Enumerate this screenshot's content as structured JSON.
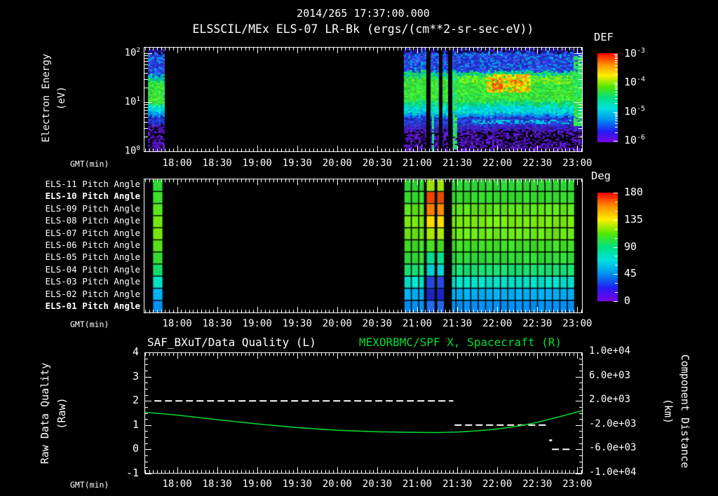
{
  "header": {
    "timestamp": "2014/265 17:37:00.000",
    "instrument_title": "ELSSCIL/MEx ELS-07 LR-Bk  (ergs/(cm**2-sr-sec-eV))"
  },
  "time_axis": {
    "label": "GMT(min)",
    "tick_labels": [
      "18:00",
      "18:30",
      "19:00",
      "19:30",
      "20:00",
      "20:30",
      "21:00",
      "21:30",
      "22:00",
      "22:30",
      "23:00"
    ],
    "start": "17:35",
    "end": "23:04"
  },
  "panel_energy": {
    "ylabel_line1": "Electron Energy",
    "ylabel_line2": "(eV)",
    "ytick_exponents": [
      "2",
      "1",
      "0"
    ],
    "colorbar": {
      "title": "DEF",
      "tick_exponents": [
        "-3",
        "-4",
        "-5",
        "-6"
      ]
    }
  },
  "panel_pitch": {
    "row_labels": [
      "ELS-11 Pitch Angle",
      "ELS-10 Pitch Angle",
      "ELS-09 Pitch Angle",
      "ELS-08 Pitch Angle",
      "ELS-07 Pitch Angle",
      "ELS-06 Pitch Angle",
      "ELS-05 Pitch Angle",
      "ELS-04 Pitch Angle",
      "ELS-03 Pitch Angle",
      "ELS-02 Pitch Angle",
      "ELS-01 Pitch Angle"
    ],
    "bold_rows": [
      "ELS-10 Pitch Angle",
      "ELS-01 Pitch Angle"
    ],
    "colorbar": {
      "title": "Deg",
      "ticks": [
        "180",
        "135",
        "90",
        "45",
        "0"
      ]
    }
  },
  "panel_line": {
    "title_left": "SAF_BXuT/Data Quality (L)",
    "title_right": "MEXORBMC/SPF X, Spacecraft (R)",
    "ylabel_line1": "Raw Data Quality",
    "ylabel_line2": "(Raw)",
    "ytick_labels": [
      "4",
      "3",
      "2",
      "1",
      "0",
      "-1"
    ],
    "y2label_line1": "Component Distance",
    "y2label_line2": "(km)",
    "y2tick_labels": [
      "1.0e+04",
      "6.0e+03",
      "2.0e+03",
      "-2.0e+03",
      "-6.0e+03",
      "-1.0e+04"
    ]
  },
  "colors": {
    "background": "#000000",
    "foreground": "#ffffff",
    "title_right_green": "#00dd33",
    "spacecraft_line_green": "#00d22c",
    "rainbow_gradient": [
      "#ff0000",
      "#ff9000",
      "#ffee00",
      "#55e800",
      "#00e080",
      "#00e0e0",
      "#0090f0",
      "#2020f0",
      "#7a00e8"
    ]
  },
  "chart_data": [
    {
      "type": "heatmap",
      "name": "electron-energy-spectrogram",
      "xlabel": "GMT(min)",
      "x_range": [
        "17:35",
        "23:04"
      ],
      "ylabel": "Electron Energy (eV)",
      "y_scale": "log",
      "y_range_ev": [
        1,
        140
      ],
      "colorbar_title": "DEF",
      "colorbar_units": "ergs/(cm**2-sr-sec-eV)",
      "colorbar_range": [
        1e-06,
        0.001
      ],
      "segments": [
        {
          "start": "17:38",
          "end": "17:50",
          "bands": [
            {
              "frac": [
                0.0,
                0.05
              ],
              "def": 3e-06,
              "colors": [
                "#1c1498",
                "#2a18ac",
                "#14106c",
                "#000000"
              ]
            },
            {
              "frac": [
                0.05,
                0.27
              ],
              "def": 1e-05,
              "colors": [
                "#2336d8",
                "#2c44e4",
                "#1a2cc0",
                "#3a55ec",
                "#00a0e0"
              ]
            },
            {
              "frac": [
                0.27,
                0.33
              ],
              "def": 4e-05,
              "colors": [
                "#00c890",
                "#18d868",
                "#00bcc8"
              ]
            },
            {
              "frac": [
                0.33,
                0.55
              ],
              "def": 0.00012,
              "colors": [
                "#30e040",
                "#3ce438",
                "#28dc50",
                "#52e82c"
              ]
            },
            {
              "frac": [
                0.55,
                0.62
              ],
              "def": 4e-05,
              "colors": [
                "#00d8d8",
                "#00c8e8",
                "#00e4c0"
              ]
            },
            {
              "frac": [
                0.62,
                0.66
              ],
              "def": 2e-05,
              "colors": [
                "#00a0f0",
                "#0090e8"
              ]
            },
            {
              "frac": [
                0.66,
                0.74
              ],
              "def": 1e-05,
              "colors": [
                "#2038cc",
                "#2844dc",
                "#1828b0"
              ]
            },
            {
              "frac": [
                0.74,
                1.0
              ],
              "def": 2e-06,
              "colors": [
                "#5414c0",
                "#440ea4",
                "#6420d4",
                "#000000",
                "#30087c",
                "#000000"
              ]
            }
          ]
        },
        {
          "start": "20:50",
          "end": "23:03",
          "bands": [
            {
              "frac": [
                0.0,
                0.045
              ],
              "def": 3e-06,
              "colors": [
                "#1c1498",
                "#2a18ac",
                "#14106c",
                "#000000"
              ]
            },
            {
              "frac": [
                0.045,
                0.23
              ],
              "def": 1e-05,
              "colors": [
                "#2336d8",
                "#2c44e4",
                "#1a2cc0",
                "#3a55ec",
                "#00a0e0"
              ]
            },
            {
              "frac": [
                0.23,
                0.29
              ],
              "def": 4e-05,
              "colors": [
                "#00c890",
                "#18d868",
                "#00bcc8",
                "#2ce04a"
              ]
            },
            {
              "frac": [
                0.29,
                0.52
              ],
              "def": 0.00015,
              "colors": [
                "#30e040",
                "#3ce438",
                "#28dc50",
                "#52e82c"
              ]
            },
            {
              "frac": [
                0.52,
                0.565
              ],
              "def": 6e-05,
              "colors": [
                "#10d888",
                "#00dcb0",
                "#1ed862"
              ]
            },
            {
              "frac": [
                0.565,
                0.635
              ],
              "def": 3e-05,
              "colors": [
                "#00d8d8",
                "#00c8e8",
                "#00e4c0"
              ]
            },
            {
              "frac": [
                0.635,
                0.665
              ],
              "def": 2e-05,
              "colors": [
                "#00a0f0",
                "#0090e8"
              ]
            },
            {
              "frac": [
                0.665,
                0.75
              ],
              "def": 1e-05,
              "colors": [
                "#2038cc",
                "#2844dc",
                "#1828b0",
                "#3050e4"
              ]
            },
            {
              "frac": [
                0.75,
                0.8
              ],
              "def": 5e-06,
              "colors": [
                "#3820b8",
                "#2c18a8",
                "#4828cc"
              ]
            },
            {
              "frac": [
                0.8,
                1.0
              ],
              "def": 2e-06,
              "colors": [
                "#5414c0",
                "#440ea4",
                "#6420d4",
                "#000000",
                "#30087c",
                "#000000"
              ]
            }
          ],
          "enhancements": [
            {
              "start": "21:30",
              "end": "22:56",
              "frac": [
                0.27,
                0.35
              ],
              "def": 0.0002,
              "colors": [
                "#7ce818",
                "#98ec0c",
                "#52e82c"
              ],
              "density": 0.55
            },
            {
              "start": "21:52",
              "end": "22:25",
              "frac": [
                0.26,
                0.43
              ],
              "def": 0.0003,
              "colors": [
                "#d8ec00",
                "#ffe400",
                "#fac800",
                "#ff9800"
              ],
              "density": 0.75
            },
            {
              "start": "21:56",
              "end": "22:04",
              "frac": [
                0.3,
                0.41
              ],
              "def": 0.0006,
              "colors": [
                "#ff7000",
                "#ff4600",
                "#ff9800"
              ],
              "density": 0.7
            },
            {
              "start": "22:10",
              "end": "22:19",
              "frac": [
                0.3,
                0.38
              ],
              "def": 0.0005,
              "colors": [
                "#ff8400",
                "#ffb000",
                "#ff6000"
              ],
              "density": 0.6
            },
            {
              "start": "21:40",
              "end": "22:55",
              "frac": [
                0.695,
                0.73
              ],
              "def": 3e-05,
              "colors": [
                "#00c8d8",
                "#00b4e0"
              ],
              "density": 0.5
            },
            {
              "start": "22:57",
              "end": "23:03",
              "frac": [
                0.08,
                0.75
              ],
              "def": 0.00012,
              "colors": [
                "#2ce44a",
                "#3ce83c",
                "#20e080"
              ],
              "density": 0.85
            },
            {
              "start": "21:27",
              "end": "21:29",
              "frac": [
                0.25,
                0.97
              ],
              "def": 0.0001,
              "colors": [
                "#2ce44a",
                "#20e080"
              ],
              "density": 0.9
            },
            {
              "start": "21:11",
              "end": "21:12",
              "frac": [
                0.55,
                1.0
              ],
              "def": 8e-05,
              "colors": [
                "#20e080",
                "#00d8b0"
              ],
              "density": 0.9
            }
          ],
          "gaps": [
            [
              "21:07",
              "21:10"
            ],
            [
              "21:16",
              "21:19"
            ],
            [
              "21:23",
              "21:26"
            ]
          ]
        }
      ]
    },
    {
      "type": "heatmap",
      "name": "pitch-angle-panels",
      "rows": [
        "ELS-11",
        "ELS-10",
        "ELS-09",
        "ELS-08",
        "ELS-07",
        "ELS-06",
        "ELS-05",
        "ELS-04",
        "ELS-03",
        "ELS-02",
        "ELS-01"
      ],
      "value_units": "deg",
      "colorbar_range": [
        0,
        180
      ],
      "segments": [
        {
          "start": "17:42",
          "end": "17:49",
          "style": "strip",
          "pitch_deg": [
            103,
            104,
            112,
            121,
            124,
            114,
            105,
            88,
            63,
            46,
            34
          ],
          "colors": [
            "#2ed636",
            "#3cdc2a",
            "#55e21e",
            "#70e812",
            "#7cec0c",
            "#58e41c",
            "#36da30",
            "#14dd6c",
            "#00e4c6",
            "#00b2f4",
            "#0092f2"
          ]
        },
        {
          "start": "20:50",
          "end": "22:58",
          "style": "grid",
          "columns": 23,
          "pitch_deg": [
            103,
            105,
            115,
            123,
            119,
            108,
            101,
            87,
            62,
            44,
            32
          ],
          "colors": [
            "#2ed636",
            "#36da2e",
            "#5ee41a",
            "#78ea0e",
            "#6ae816",
            "#40dc26",
            "#30da3a",
            "#18dd72",
            "#00e2ca",
            "#00aef4",
            "#008ef2"
          ],
          "gaps": [
            [
              "21:05",
              "21:07"
            ],
            [
              "21:13",
              "21:15"
            ],
            [
              "21:20",
              "21:26"
            ]
          ],
          "anomalous_columns": [
            {
              "start": "21:07",
              "end": "21:13",
              "pitch_deg": [
                128,
                172,
                156,
                137,
                127,
                106,
                78,
                62,
                38,
                26,
                42
              ],
              "colors": [
                "#a0e80a",
                "#f04000",
                "#ff7c00",
                "#ffd800",
                "#ace806",
                "#46dc22",
                "#00dc8e",
                "#00d6da",
                "#2a46e2",
                "#1c22c2",
                "#2468ea"
              ]
            },
            {
              "start": "21:15",
              "end": "21:20",
              "pitch_deg": [
                126,
                170,
                152,
                136,
                126,
                104,
                76,
                60,
                36,
                24,
                40
              ],
              "colors": [
                "#a0e80a",
                "#ee4800",
                "#ff8600",
                "#ffd800",
                "#ace806",
                "#46dc22",
                "#00dc8e",
                "#00d6da",
                "#2a46e2",
                "#1c22c2",
                "#2468ea"
              ]
            }
          ]
        }
      ]
    },
    {
      "type": "line",
      "name": "quality-and-spacecraft-distance",
      "xlabel": "GMT(min)",
      "left_axis": {
        "label": "Raw Data Quality (Raw)",
        "range": [
          -1,
          4
        ]
      },
      "right_axis": {
        "label": "Component Distance (km)",
        "range": [
          -10000,
          10000
        ]
      },
      "series": [
        {
          "name": "SAF_BXuT/Data Quality (L)",
          "axis": "left",
          "color": "#ffffff",
          "style": "dashed",
          "segments": [
            {
              "value": 2,
              "start": "17:43",
              "end": "21:27"
            },
            {
              "value": 1,
              "start": "21:28",
              "end": "22:38"
            },
            {
              "value": 0,
              "start": "22:41",
              "end": "22:55"
            }
          ],
          "isolated_points": [
            {
              "time": "22:40",
              "value": 0.38
            }
          ]
        },
        {
          "name": "MEXORBMC/SPF X, Spacecraft (R)",
          "axis": "right",
          "color": "#00d22c",
          "style": "solid",
          "units": "km",
          "points": [
            [
              "17:35",
              150
            ],
            [
              "18:00",
              -350
            ],
            [
              "18:30",
              -1100
            ],
            [
              "19:00",
              -1800
            ],
            [
              "19:30",
              -2400
            ],
            [
              "20:00",
              -2850
            ],
            [
              "20:30",
              -3100
            ],
            [
              "21:00",
              -3200
            ],
            [
              "21:15",
              -3230
            ],
            [
              "21:30",
              -3150
            ],
            [
              "21:45",
              -2950
            ],
            [
              "22:00",
              -2650
            ],
            [
              "22:15",
              -2200
            ],
            [
              "22:30",
              -1550
            ],
            [
              "22:45",
              -700
            ],
            [
              "23:04",
              400
            ]
          ]
        }
      ]
    }
  ]
}
